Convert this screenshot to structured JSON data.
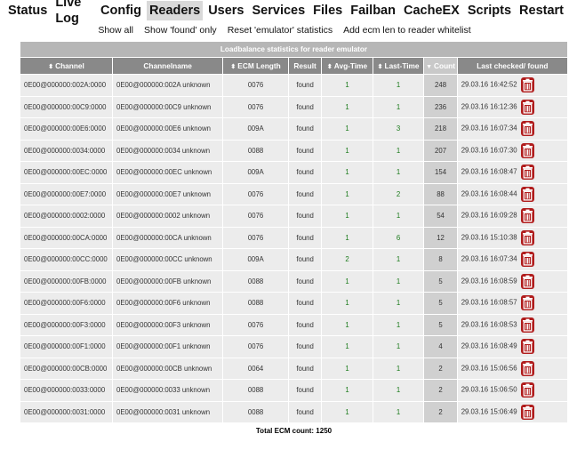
{
  "nav": [
    "Status",
    "Live Log",
    "Config",
    "Readers",
    "Users",
    "Services",
    "Files",
    "Failban",
    "CacheEX",
    "Scripts",
    "Restart"
  ],
  "active_nav": "Readers",
  "subnav": [
    "Show all",
    "Show 'found' only",
    "Reset 'emulator' statistics",
    "Add ecm len to reader whitelist"
  ],
  "table": {
    "caption": "Loadbalance statistics for reader emulator",
    "headers": [
      "Channel",
      "Channelname",
      "ECM Length",
      "Result",
      "Avg-Time",
      "Last-Time",
      "Count",
      "Last checked/ found"
    ],
    "rows": [
      {
        "channel": "0E00@000000:002A:0000",
        "name": "0E00@000000:002A unknown",
        "ecm": "0076",
        "result": "found",
        "avg": "1",
        "last": "1",
        "count": "248",
        "checked": "29.03.16 16:42:52"
      },
      {
        "channel": "0E00@000000:00C9:0000",
        "name": "0E00@000000:00C9 unknown",
        "ecm": "0076",
        "result": "found",
        "avg": "1",
        "last": "1",
        "count": "236",
        "checked": "29.03.16 16:12:36"
      },
      {
        "channel": "0E00@000000:00E6:0000",
        "name": "0E00@000000:00E6 unknown",
        "ecm": "009A",
        "result": "found",
        "avg": "1",
        "last": "3",
        "count": "218",
        "checked": "29.03.16 16:07:34"
      },
      {
        "channel": "0E00@000000:0034:0000",
        "name": "0E00@000000:0034 unknown",
        "ecm": "0088",
        "result": "found",
        "avg": "1",
        "last": "1",
        "count": "207",
        "checked": "29.03.16 16:07:30"
      },
      {
        "channel": "0E00@000000:00EC:0000",
        "name": "0E00@000000:00EC unknown",
        "ecm": "009A",
        "result": "found",
        "avg": "1",
        "last": "1",
        "count": "154",
        "checked": "29.03.16 16:08:47"
      },
      {
        "channel": "0E00@000000:00E7:0000",
        "name": "0E00@000000:00E7 unknown",
        "ecm": "0076",
        "result": "found",
        "avg": "1",
        "last": "2",
        "count": "88",
        "checked": "29.03.16 16:08:44"
      },
      {
        "channel": "0E00@000000:0002:0000",
        "name": "0E00@000000:0002 unknown",
        "ecm": "0076",
        "result": "found",
        "avg": "1",
        "last": "1",
        "count": "54",
        "checked": "29.03.16 16:09:28"
      },
      {
        "channel": "0E00@000000:00CA:0000",
        "name": "0E00@000000:00CA unknown",
        "ecm": "0076",
        "result": "found",
        "avg": "1",
        "last": "6",
        "count": "12",
        "checked": "29.03.16 15:10:38"
      },
      {
        "channel": "0E00@000000:00CC:0000",
        "name": "0E00@000000:00CC unknown",
        "ecm": "009A",
        "result": "found",
        "avg": "2",
        "last": "1",
        "count": "8",
        "checked": "29.03.16 16:07:34"
      },
      {
        "channel": "0E00@000000:00FB:0000",
        "name": "0E00@000000:00FB unknown",
        "ecm": "0088",
        "result": "found",
        "avg": "1",
        "last": "1",
        "count": "5",
        "checked": "29.03.16 16:08:59"
      },
      {
        "channel": "0E00@000000:00F6:0000",
        "name": "0E00@000000:00F6 unknown",
        "ecm": "0088",
        "result": "found",
        "avg": "1",
        "last": "1",
        "count": "5",
        "checked": "29.03.16 16:08:57"
      },
      {
        "channel": "0E00@000000:00F3:0000",
        "name": "0E00@000000:00F3 unknown",
        "ecm": "0076",
        "result": "found",
        "avg": "1",
        "last": "1",
        "count": "5",
        "checked": "29.03.16 16:08:53"
      },
      {
        "channel": "0E00@000000:00F1:0000",
        "name": "0E00@000000:00F1 unknown",
        "ecm": "0076",
        "result": "found",
        "avg": "1",
        "last": "1",
        "count": "4",
        "checked": "29.03.16 16:08:49"
      },
      {
        "channel": "0E00@000000:00CB:0000",
        "name": "0E00@000000:00CB unknown",
        "ecm": "0064",
        "result": "found",
        "avg": "1",
        "last": "1",
        "count": "2",
        "checked": "29.03.16 15:06:56"
      },
      {
        "channel": "0E00@000000:0033:0000",
        "name": "0E00@000000:0033 unknown",
        "ecm": "0088",
        "result": "found",
        "avg": "1",
        "last": "1",
        "count": "2",
        "checked": "29.03.16 15:06:50"
      },
      {
        "channel": "0E00@000000:0031:0000",
        "name": "0E00@000000:0031 unknown",
        "ecm": "0088",
        "result": "found",
        "avg": "1",
        "last": "1",
        "count": "2",
        "checked": "29.03.16 15:06:49"
      }
    ]
  },
  "total": "Total ECM count: 1250",
  "colors": {
    "header": "#898989",
    "caption": "#b6b6b6",
    "row": "#ececec",
    "count": "#d0d0d0",
    "num_green": "#1a7a1a",
    "delete_red": "#b01c1c"
  },
  "icons": {
    "delete": "trash-icon",
    "sort": "sort-arrows-icon"
  }
}
